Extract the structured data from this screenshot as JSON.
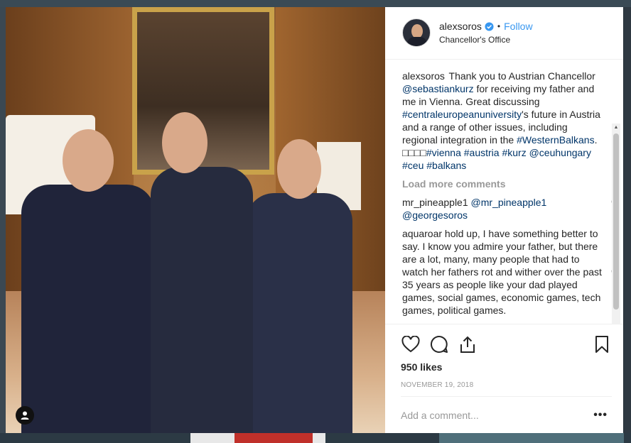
{
  "post": {
    "username": "alexsoros",
    "follow_label": "Follow",
    "dot": "•",
    "location": "Chancellor's Office",
    "caption_user": "alexsoros",
    "caption_parts": [
      {
        "text": " Thank you to Austrian Chancellor ",
        "link": false
      },
      {
        "text": "@sebastiankurz",
        "link": true
      },
      {
        "text": " for receiving my father and me in Vienna. Great discussing ",
        "link": false
      },
      {
        "text": "#centraleuropeanuniversity",
        "link": true
      },
      {
        "text": "'s future in Austria and a range of other issues, including regional integration in the ",
        "link": false
      },
      {
        "text": "#WesternBalkans",
        "link": true
      },
      {
        "text": ". □□□□",
        "link": false
      },
      {
        "text": "#vienna",
        "link": true
      },
      {
        "text": " ",
        "link": false
      },
      {
        "text": "#austria",
        "link": true
      },
      {
        "text": " ",
        "link": false
      },
      {
        "text": "#kurz",
        "link": true
      },
      {
        "text": " ",
        "link": false
      },
      {
        "text": "@ceuhungary",
        "link": true
      },
      {
        "text": " ",
        "link": false
      },
      {
        "text": "#ceu",
        "link": true
      },
      {
        "text": " ",
        "link": false
      },
      {
        "text": "#balkans",
        "link": true
      }
    ],
    "load_more": "Load more comments",
    "comments": [
      {
        "user": "mr_pineapple1",
        "parts": [
          {
            "text": " ",
            "link": false
          },
          {
            "text": "@mr_pineapple1",
            "link": true
          },
          {
            "text": " ",
            "link": false
          },
          {
            "text": "@georgesoros",
            "link": true
          }
        ]
      },
      {
        "user": "aquaroar",
        "parts": [
          {
            "text": " hold up, I have something better to say. I know you admire your father, but there are a lot, many, many people that had to watch her fathers rot and wither over the past 35 years as people like your dad played games, social games, economic games, tech games, political games.",
            "link": false
          }
        ]
      }
    ],
    "likes": "950 likes",
    "date": "NOVEMBER 19, 2018",
    "add_comment_placeholder": "Add a comment...",
    "more_label": "•••"
  },
  "icons": {
    "verified": "verified-badge-icon",
    "heart": "heart-icon",
    "comment": "comment-icon",
    "share": "share-icon",
    "bookmark": "bookmark-icon",
    "user": "user-icon"
  },
  "colors": {
    "link": "#003569",
    "follow": "#3897f0",
    "muted": "#999999",
    "text": "#262626"
  }
}
